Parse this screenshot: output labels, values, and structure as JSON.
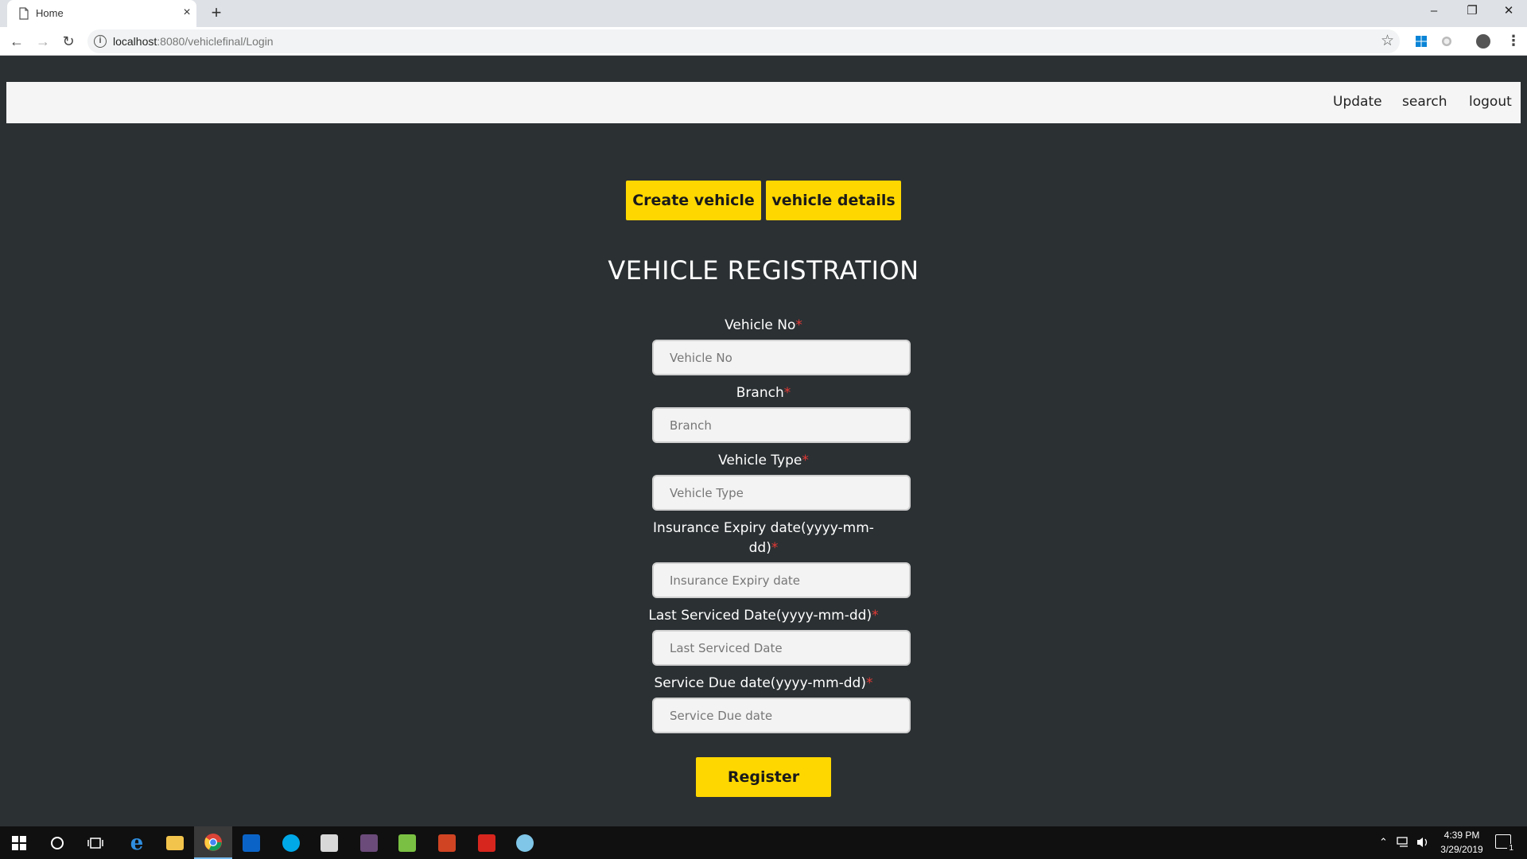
{
  "browser": {
    "tab_title": "Home",
    "tab_close": "×",
    "new_tab": "+",
    "url_host": "localhost",
    "url_path": ":8080/vehiclefinal/Login",
    "window_controls": {
      "minimize": "–",
      "maximize": "❐",
      "close": "✕"
    },
    "nav": {
      "back": "←",
      "forward": "→",
      "reload": "↻"
    },
    "star": "☆",
    "menu": "⋮"
  },
  "topnav": {
    "links": [
      "Update",
      "search",
      "logout"
    ]
  },
  "actions": {
    "create_vehicle": "Create vehicle",
    "vehicle_details": "vehicle details"
  },
  "page_title": "VEHICLE REGISTRATION",
  "required_mark": "*",
  "form": {
    "fields": [
      {
        "label": "Vehicle No",
        "placeholder": "Vehicle No"
      },
      {
        "label": "Branch",
        "placeholder": "Branch"
      },
      {
        "label": "Vehicle Type",
        "placeholder": "Vehicle Type"
      },
      {
        "label": "Insurance Expiry date(yyyy-mm-dd)",
        "placeholder": "Insurance Expiry date"
      },
      {
        "label": "Last Serviced Date(yyyy-mm-dd)",
        "placeholder": "Last Serviced Date"
      },
      {
        "label": "Service Due date(yyyy-mm-dd)",
        "placeholder": "Service Due date"
      }
    ],
    "submit_label": "Register"
  },
  "taskbar": {
    "time": "4:39 PM",
    "date": "3/29/2019",
    "notification_count": "1"
  },
  "colors": {
    "page_bg": "#2b3033",
    "accent": "#ffd700",
    "required": "#e53935"
  }
}
